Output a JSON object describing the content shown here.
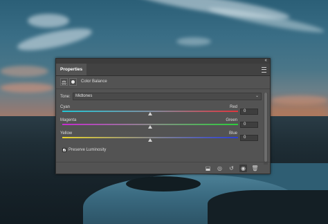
{
  "panel": {
    "tab_label": "Properties",
    "collapse_glyph": "‹‹",
    "adjustment_title": "Color Balance",
    "tone_label": "Tone:",
    "tone_value": "Midtones",
    "sliders": [
      {
        "left_label": "Cyan",
        "right_label": "Red",
        "value": "0"
      },
      {
        "left_label": "Magenta",
        "right_label": "Green",
        "value": "0"
      },
      {
        "left_label": "Yellow",
        "right_label": "Blue",
        "value": "0"
      }
    ],
    "preserve_label": "Preserve Luminosity",
    "preserve_checked": true,
    "icons": {
      "header": [
        "color-balance-icon",
        "layer-mask-icon"
      ],
      "footer": [
        "clip-to-layer-icon",
        "view-previous-state-icon",
        "reset-icon",
        "visibility-icon",
        "delete-icon"
      ]
    }
  },
  "colors": {
    "panel_bg": "#535353",
    "cyan": "#22c7d6",
    "red": "#e0353d",
    "magenta": "#c72bd0",
    "green": "#2ccf3b",
    "yellow": "#e8d42b",
    "blue": "#2b3fd6"
  }
}
